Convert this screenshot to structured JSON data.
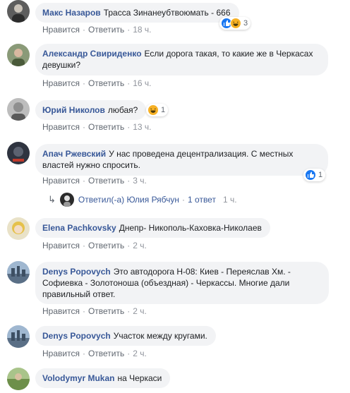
{
  "comments": [
    {
      "author": "Макс Назаров",
      "text": "Трасса Зинанеубтвоюмать - 666",
      "like": "Нравится",
      "reply": "Ответить",
      "time": "18 ч.",
      "reactions": {
        "icons": [
          "like-icon",
          "haha-icon"
        ],
        "count": "3"
      }
    },
    {
      "author": "Александр Свириденко",
      "text": "Если дорога такая, то какие же в Черкасах девушки?",
      "like": "Нравится",
      "reply": "Ответить",
      "time": "16 ч."
    },
    {
      "author": "Юрий Николов",
      "text": "любая?",
      "like": "Нравится",
      "reply": "Ответить",
      "time": "13 ч.",
      "reactions": {
        "icons": [
          "haha-icon"
        ],
        "count": "1"
      }
    },
    {
      "author": "Апач Ржевский",
      "text": "У нас проведена децентрализация. С местных властей нужно спросить.",
      "like": "Нравится",
      "reply": "Ответить",
      "time": "3 ч.",
      "reactions": {
        "icons": [
          "like-icon"
        ],
        "count": "1"
      },
      "replies": {
        "text": "Ответил(-а) Юлия Рябчун",
        "count": "1 ответ",
        "time": "1 ч."
      }
    },
    {
      "author": "Elena Pachkovsky",
      "text": "Днепр- Никополь-Каховка-Николаев",
      "like": "Нравится",
      "reply": "Ответить",
      "time": "2 ч."
    },
    {
      "author": "Denys Popovych",
      "text": "Это автодорога Н-08: Киев - Переяслав Хм. - Софиевка - Золотоноша (объездная) - Черкассы. Многие дали правильный ответ.",
      "like": "Нравится",
      "reply": "Ответить",
      "time": "2 ч."
    },
    {
      "author": "Denys Popovych",
      "text": "Участок между кругами.",
      "like": "Нравится",
      "reply": "Ответить",
      "time": "2 ч."
    },
    {
      "author": "Volodymyr Mukan",
      "text": "на Черкаси"
    }
  ],
  "colors": {
    "bubble_bg": "#f2f3f5",
    "author_link": "#385898",
    "like_blue": "#1877f2",
    "haha_yellow": "#f7b125",
    "meta_gray": "#90949c"
  }
}
